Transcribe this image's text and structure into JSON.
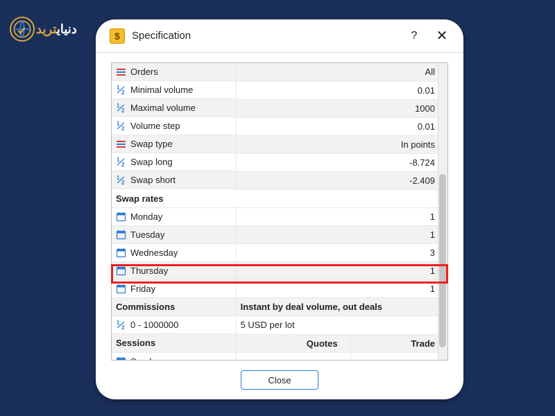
{
  "brand": {
    "name": "دنیای",
    "accent": "ترید"
  },
  "dialog": {
    "title": "Specification",
    "close": "Close",
    "rows": [
      {
        "icon": "hlines",
        "label": "Orders",
        "value": "All",
        "alt": true
      },
      {
        "icon": "half",
        "label": "Minimal volume",
        "value": "0.01"
      },
      {
        "icon": "half",
        "label": "Maximal volume",
        "value": "1000",
        "alt": true
      },
      {
        "icon": "half",
        "label": "Volume step",
        "value": "0.01"
      },
      {
        "icon": "hlines",
        "label": "Swap type",
        "value": "In points",
        "alt": true
      },
      {
        "icon": "half",
        "label": "Swap long",
        "value": "-8.724"
      },
      {
        "icon": "half",
        "label": "Swap short",
        "value": "-2.409",
        "alt": true
      }
    ],
    "swap_header": "Swap rates",
    "days": [
      {
        "icon": "calendar",
        "label": "Monday",
        "value": "1"
      },
      {
        "icon": "calendar",
        "label": "Tuesday",
        "value": "1",
        "alt": true
      },
      {
        "icon": "calendar",
        "label": "Wednesday",
        "value": "3",
        "hl": true
      },
      {
        "icon": "calendar",
        "label": "Thursday",
        "value": "1",
        "alt": true
      },
      {
        "icon": "calendar",
        "label": "Friday",
        "value": "1"
      }
    ],
    "commissions": {
      "header": "Commissions",
      "mode": "Instant by deal volume, out deals",
      "range": "0 - 1000000",
      "fee": "5 USD per lot"
    },
    "sessions": {
      "header": "Sessions",
      "quotes": "Quotes",
      "trade": "Trade",
      "sunday": "Sunday"
    }
  }
}
